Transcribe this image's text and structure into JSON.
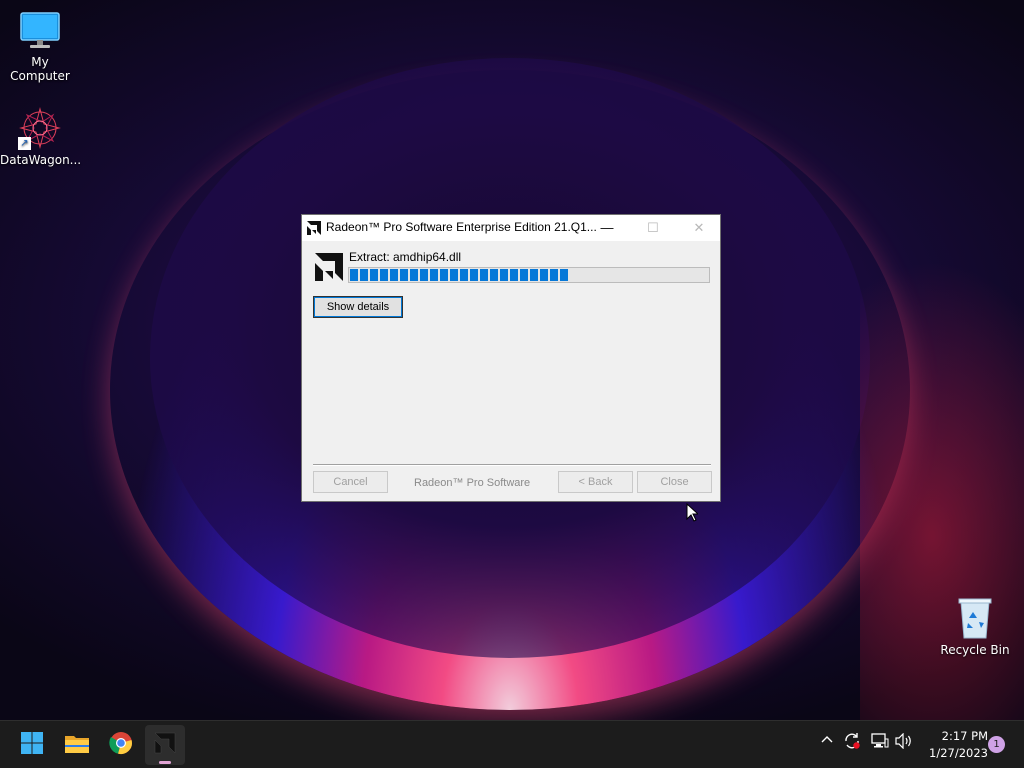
{
  "desktop": {
    "icons": [
      {
        "label": "My Computer",
        "icon": "monitor-icon"
      },
      {
        "label": "DataWagon...",
        "icon": "datawagon-shortcut-icon"
      },
      {
        "label": "Recycle Bin",
        "icon": "recycle-bin-icon"
      }
    ]
  },
  "dialog": {
    "title": "Radeon™ Pro Software Enterprise Edition 21.Q1...",
    "title_icon": "amd-logo-icon",
    "buttons": {
      "minimize": "—",
      "maximize": "☐",
      "close": "✕"
    },
    "extract_label": "Extract: amdhip64.dll",
    "progress_percent": 61,
    "show_details_label": "Show details",
    "footer": {
      "cancel_label": "Cancel",
      "brand": "Radeon™ Pro Software",
      "back_label": "< Back",
      "close_label": "Close"
    }
  },
  "taskbar": {
    "apps": [
      {
        "name": "start-button",
        "icon": "windows-logo-icon"
      },
      {
        "name": "file-explorer",
        "icon": "folder-icon"
      },
      {
        "name": "chrome",
        "icon": "chrome-icon"
      },
      {
        "name": "amd-installer",
        "icon": "amd-logo-icon",
        "active": true
      }
    ],
    "tray": {
      "icons": [
        "chevron-up-icon",
        "sync-icon",
        "network-icon",
        "volume-icon"
      ]
    },
    "clock": {
      "time": "2:17 PM",
      "date": "1/27/2023"
    },
    "notification_count": "1"
  },
  "colors": {
    "accent": "#0678d8",
    "taskbar": "#1c1c1c"
  }
}
